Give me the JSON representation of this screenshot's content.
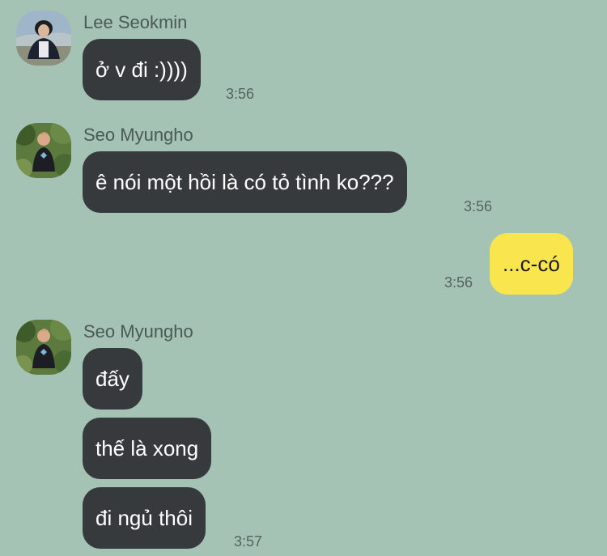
{
  "colors": {
    "background": "#a4c3b4",
    "incoming_bubble": "#373a3d",
    "outgoing_bubble": "#f9e54e"
  },
  "messages": [
    {
      "sender": "Lee Seokmin",
      "avatar_icon": "profile-photo-icon",
      "texts": [
        "ở v đi :))))"
      ],
      "time": "3:56"
    },
    {
      "sender": "Seo Myungho",
      "avatar_icon": "profile-photo-icon",
      "texts": [
        "ê nói một hồi là có tỏ tình ko???"
      ],
      "time": "3:56"
    },
    {
      "sender": "",
      "outgoing": true,
      "texts": [
        "...c-có"
      ],
      "time": "3:56"
    },
    {
      "sender": "Seo Myungho",
      "avatar_icon": "profile-photo-icon",
      "texts": [
        "đấy",
        "thế là xong",
        "đi ngủ thôi"
      ],
      "time": "3:57"
    }
  ]
}
